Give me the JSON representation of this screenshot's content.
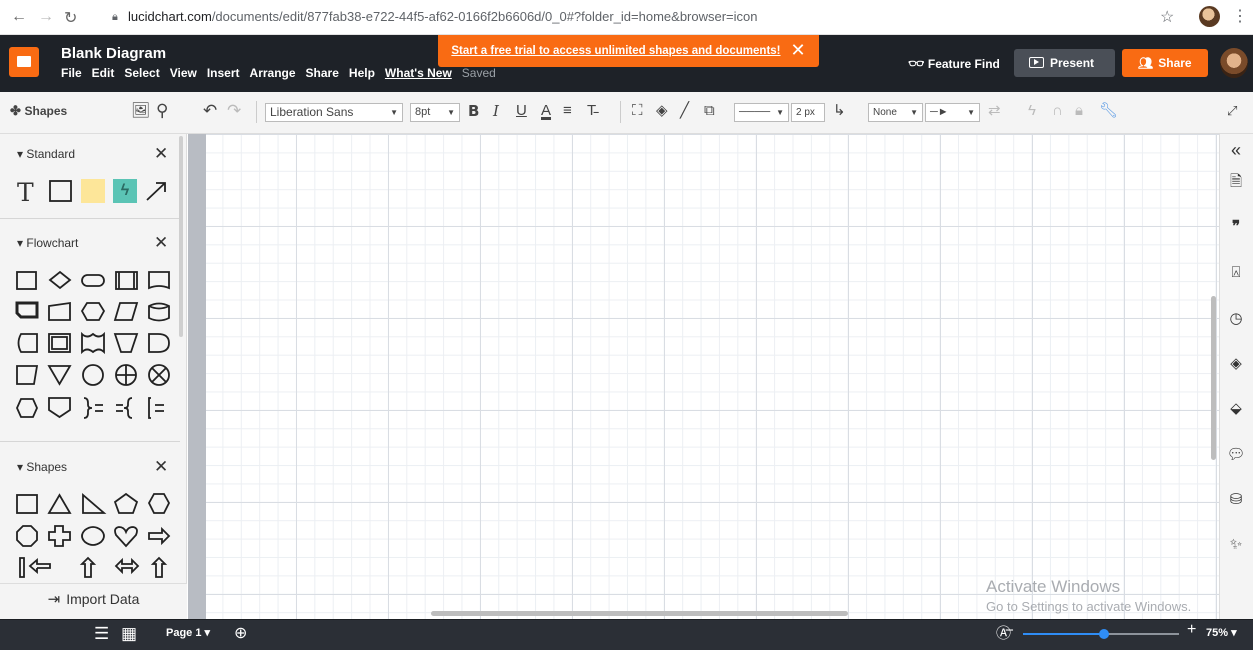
{
  "browser": {
    "url_host": "lucidchart.com",
    "url_path": "/documents/edit/877fab38-e722-44f5-af62-0166f2b6606d/0_0#?folder_id=home&browser=icon"
  },
  "header": {
    "doc_title": "Blank Diagram",
    "menu": [
      "File",
      "Edit",
      "Select",
      "View",
      "Insert",
      "Arrange",
      "Share",
      "Help"
    ],
    "whats_new": "What's New",
    "saved_status": "Saved",
    "trial_banner": "Start a free trial to access unlimited shapes and documents!",
    "feature_find": "Feature Find",
    "present": "Present",
    "share": "Share"
  },
  "toolbar": {
    "shapes_label": "Shapes",
    "font": "Liberation Sans",
    "font_size": "8pt",
    "line_width": "2 px",
    "arrow_start": "None"
  },
  "left_panel": {
    "sections": [
      {
        "title": "Standard"
      },
      {
        "title": "Flowchart"
      },
      {
        "title": "Shapes"
      }
    ],
    "import_label": "Import Data"
  },
  "canvas": {
    "watermark_title": "Activate Windows",
    "watermark_sub": "Go to Settings to activate Windows."
  },
  "bottom": {
    "page_label": "Page 1",
    "zoom": "75%",
    "zoom_level": 0.52
  },
  "colors": {
    "accent": "#f96b13",
    "header_bg": "#1e2228",
    "zoom_blue": "#2f8df5"
  }
}
